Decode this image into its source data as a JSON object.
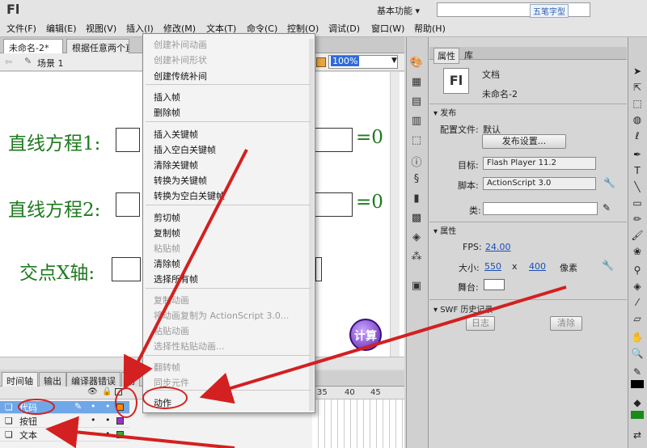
{
  "app": {
    "logo": "Fl",
    "workspace": "基本功能 ▾",
    "watermark": "五笔字型"
  },
  "menubar": {
    "items": [
      "文件(F)",
      "编辑(E)",
      "视图(V)",
      "插入(I)",
      "修改(M)",
      "文本(T)",
      "命令(C)",
      "控制(O)",
      "调试(D)",
      "窗口(W)",
      "帮助(H)"
    ]
  },
  "doctabs": [
    "未命名-2*",
    "根据任意两个直"
  ],
  "scene": {
    "label": "场景 1",
    "zoom": "100%"
  },
  "stage": {
    "line1": "直线方程1:",
    "line2": "直线方程2:",
    "line3": "交点X轴:",
    "eq1": "=0",
    "eq2": "=0",
    "calc_button": "计算"
  },
  "context_menu": {
    "items": [
      {
        "label": "创建补间动画",
        "enabled": false
      },
      {
        "label": "创建补间形状",
        "enabled": false
      },
      {
        "label": "创建传统补间",
        "enabled": true
      },
      {
        "label": "插入帧",
        "enabled": true
      },
      {
        "label": "删除帧",
        "enabled": true
      },
      {
        "label": "插入关键帧",
        "enabled": true
      },
      {
        "label": "插入空白关键帧",
        "enabled": true
      },
      {
        "label": "清除关键帧",
        "enabled": true
      },
      {
        "label": "转换为关键帧",
        "enabled": true
      },
      {
        "label": "转换为空白关键帧",
        "enabled": true
      },
      {
        "label": "剪切帧",
        "enabled": true
      },
      {
        "label": "复制帧",
        "enabled": true
      },
      {
        "label": "粘贴帧",
        "enabled": false
      },
      {
        "label": "清除帧",
        "enabled": true
      },
      {
        "label": "选择所有帧",
        "enabled": true
      },
      {
        "label": "复制动画",
        "enabled": false
      },
      {
        "label": "将动画复制为 ActionScript 3.0...",
        "enabled": false
      },
      {
        "label": "粘贴动画",
        "enabled": false
      },
      {
        "label": "选择性粘贴动画...",
        "enabled": false
      },
      {
        "label": "翻转帧",
        "enabled": false
      },
      {
        "label": "同步元件",
        "enabled": false
      },
      {
        "label": "动作",
        "enabled": true
      }
    ]
  },
  "timeline": {
    "tabs": [
      "时间轴",
      "输出",
      "编译器错误",
      "动"
    ],
    "frame_numbers": [
      "35",
      "40",
      "45"
    ],
    "layers": [
      "代码",
      "按钮",
      "文本"
    ]
  },
  "properties": {
    "tabs": [
      "属性",
      "库"
    ],
    "doc_icon": "Fl",
    "doc_type": "文档",
    "doc_name": "未命名-2",
    "publish_section": "发布",
    "profile_label": "配置文件:",
    "profile_value": "默认",
    "publish_settings_button": "发布设置...",
    "target_label": "目标:",
    "target_value": "Flash Player 11.2",
    "script_label": "脚本:",
    "script_value": "ActionScript 3.0",
    "class_label": "类:",
    "props_section": "属性",
    "fps_label": "FPS:",
    "fps_value": "24.00",
    "size_label": "大小:",
    "width": "550",
    "x_sep": "x",
    "height": "400",
    "unit": "像素",
    "stage_label": "舞台:",
    "swf_section": "SWF 历史记录",
    "log_button": "日志",
    "clear_button": "清除"
  },
  "colors": {
    "stage_text": "#1e7a1e",
    "annotation": "#d32020",
    "selected_layer": "#6fa7e8"
  }
}
